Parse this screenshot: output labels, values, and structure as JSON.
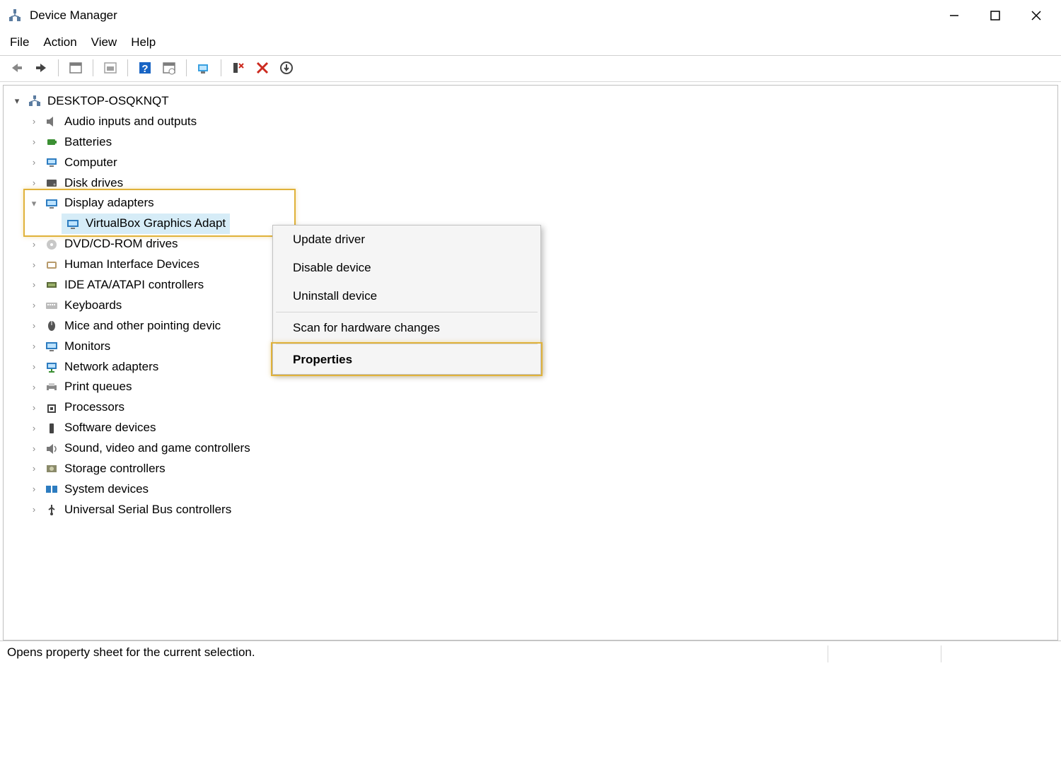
{
  "titlebar": {
    "title": "Device Manager"
  },
  "menubar": {
    "items": [
      "File",
      "Action",
      "View",
      "Help"
    ]
  },
  "tree": {
    "root": "DESKTOP-OSQKNQT",
    "nodes": [
      {
        "label": "Audio inputs and outputs",
        "icon": "audio"
      },
      {
        "label": "Batteries",
        "icon": "battery"
      },
      {
        "label": "Computer",
        "icon": "computer"
      },
      {
        "label": "Disk drives",
        "icon": "disk"
      },
      {
        "label": "Display adapters",
        "icon": "display",
        "expanded": true,
        "children": [
          {
            "label": "VirtualBox Graphics Adapt",
            "icon": "display",
            "selected": true
          }
        ]
      },
      {
        "label": "DVD/CD-ROM drives",
        "icon": "dvd"
      },
      {
        "label": "Human Interface Devices",
        "icon": "hid"
      },
      {
        "label": "IDE ATA/ATAPI controllers",
        "icon": "ide"
      },
      {
        "label": "Keyboards",
        "icon": "keyboard"
      },
      {
        "label": "Mice and other pointing devic",
        "icon": "mouse"
      },
      {
        "label": "Monitors",
        "icon": "monitor"
      },
      {
        "label": "Network adapters",
        "icon": "network"
      },
      {
        "label": "Print queues",
        "icon": "printer"
      },
      {
        "label": "Processors",
        "icon": "cpu"
      },
      {
        "label": "Software devices",
        "icon": "software"
      },
      {
        "label": "Sound, video and game controllers",
        "icon": "sound"
      },
      {
        "label": "Storage controllers",
        "icon": "storage"
      },
      {
        "label": "System devices",
        "icon": "system"
      },
      {
        "label": "Universal Serial Bus controllers",
        "icon": "usb"
      }
    ]
  },
  "context_menu": {
    "items": [
      {
        "label": "Update driver"
      },
      {
        "label": "Disable device"
      },
      {
        "label": "Uninstall device"
      },
      {
        "sep": true
      },
      {
        "label": "Scan for hardware changes"
      },
      {
        "sep": true
      },
      {
        "label": "Properties",
        "bold": true
      }
    ]
  },
  "statusbar": {
    "text": "Opens property sheet for the current selection."
  }
}
